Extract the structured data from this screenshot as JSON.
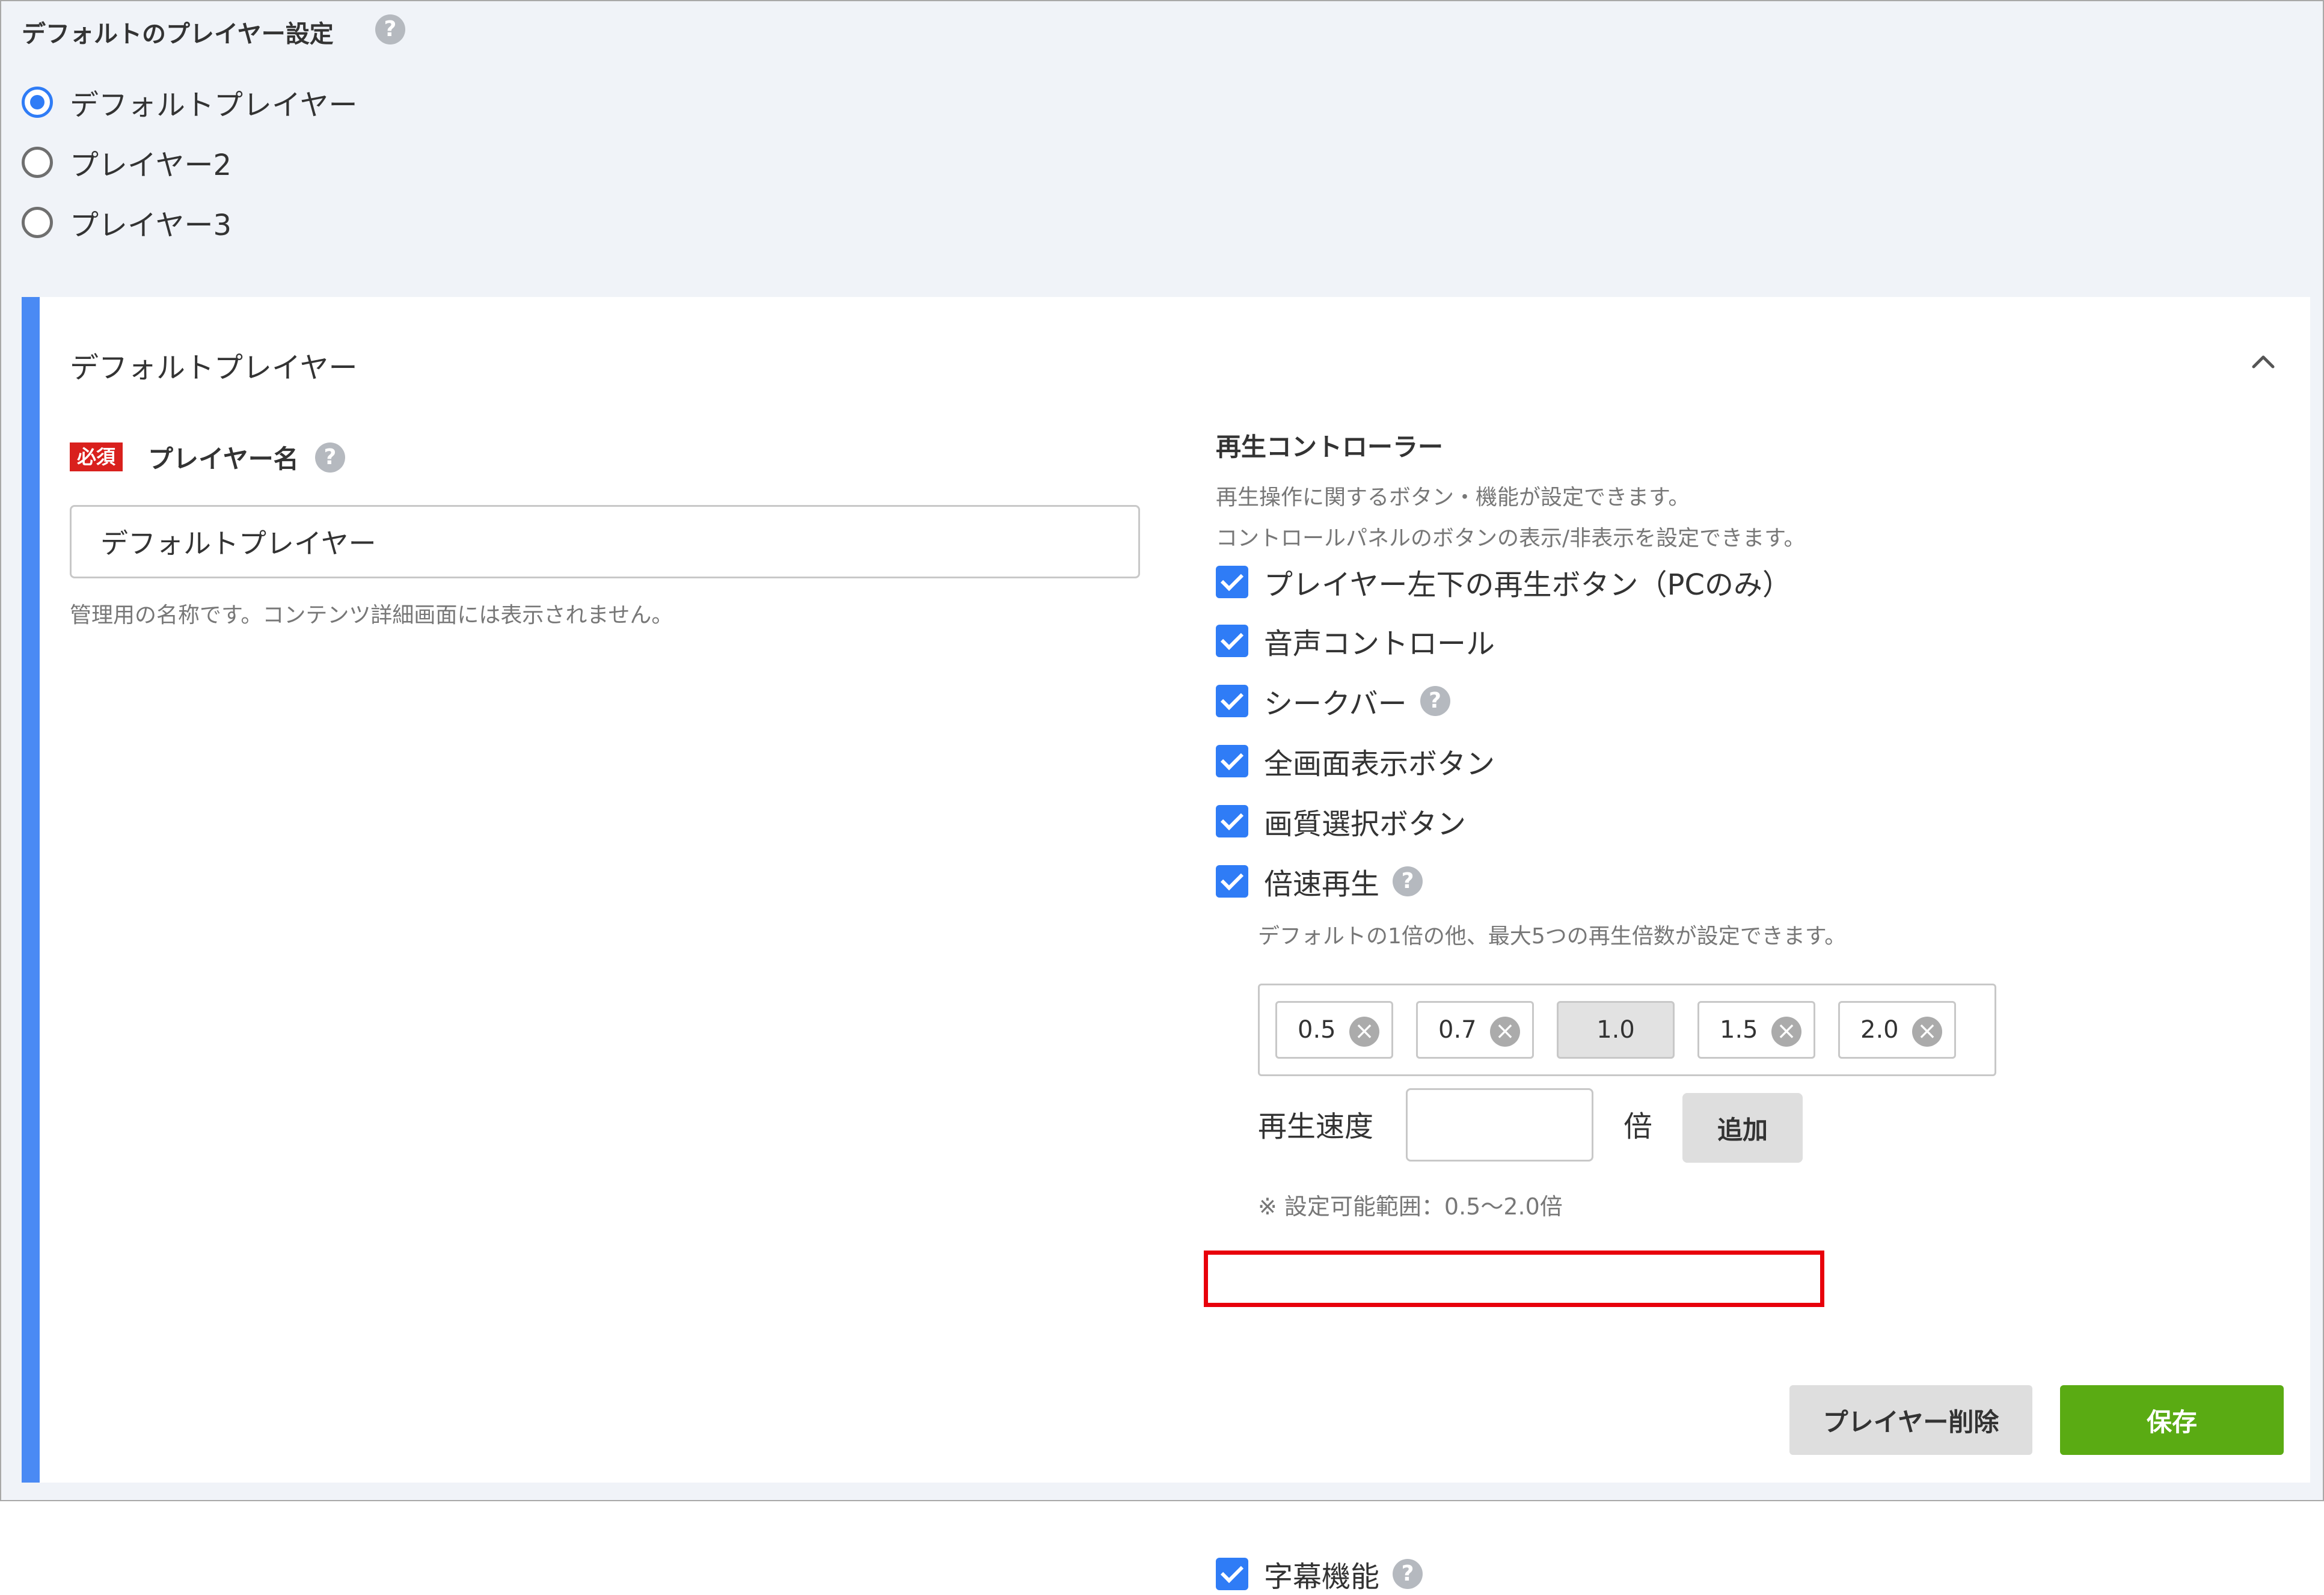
{
  "header": {
    "title": "デフォルトのプレイヤー設定",
    "help_icon": "?"
  },
  "player_options": [
    {
      "label": "デフォルトプレイヤー",
      "selected": true
    },
    {
      "label": "プレイヤー2",
      "selected": false
    },
    {
      "label": "プレイヤー3",
      "selected": false
    }
  ],
  "panel": {
    "title": "デフォルトプレイヤー",
    "collapse_icon": "chevron-up-icon"
  },
  "player_name": {
    "required_badge": "必須",
    "label": "プレイヤー名",
    "value": "デフォルトプレイヤー",
    "hint": "管理用の名称です。コンテンツ詳細画面には表示されません。"
  },
  "controller": {
    "title": "再生コントローラー",
    "desc1": "再生操作に関するボタン・機能が設定できます。",
    "desc2": "コントロールパネルのボタンの表示/非表示を設定できます。",
    "options": [
      {
        "label": "プレイヤー左下の再生ボタン（PCのみ）",
        "checked": true
      },
      {
        "label": "音声コントロール",
        "checked": true
      },
      {
        "label": "シークバー",
        "checked": true
      },
      {
        "label": "全画面表示ボタン",
        "checked": true
      },
      {
        "label": "画質選択ボタン",
        "checked": true
      },
      {
        "label": "倍速再生",
        "checked": true
      }
    ],
    "speed_hint": "デフォルトの1倍の他、最大5つの再生倍数が設定できます。",
    "speeds": [
      "0.5",
      "0.7",
      "1.0",
      "1.5",
      "2.0"
    ],
    "speed_label": "再生速度",
    "speed_input_value": "",
    "speed_unit": "倍",
    "add_button": "追加",
    "range_note": "※ 設定可能範囲：0.5〜2.0倍",
    "subtitle": {
      "label": "字幕機能",
      "checked": true
    }
  },
  "actions": {
    "delete_label": "プレイヤー削除",
    "save_label": "保存"
  },
  "colors": {
    "accent": "#2f7cf6",
    "save": "#5aab13",
    "required": "#d9201d",
    "highlight": "#e8000b"
  }
}
